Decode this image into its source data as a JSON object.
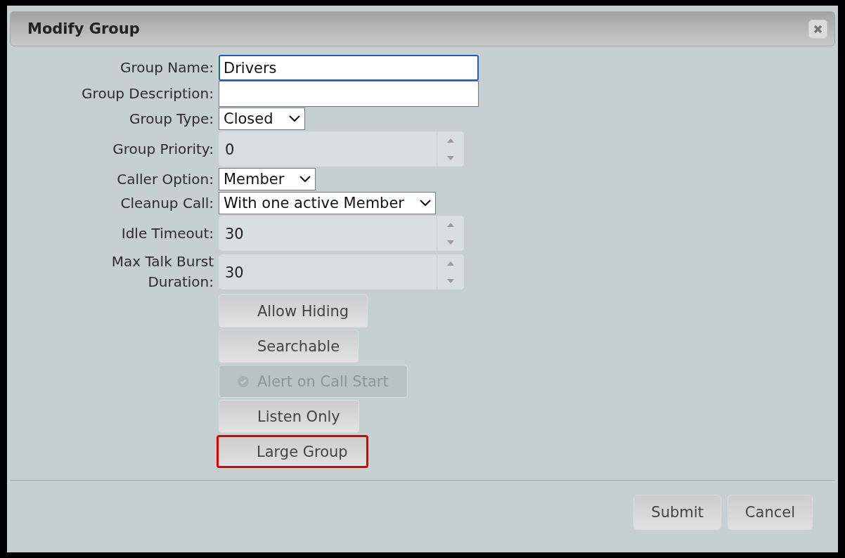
{
  "dialog": {
    "title": "Modify Group"
  },
  "fields": [
    {
      "kind": "text",
      "label": "Group Name:",
      "value": "Drivers",
      "focused": true
    },
    {
      "kind": "text",
      "label": "Group Description:",
      "focused": false
    },
    {
      "kind": "select",
      "label": "Group Type:",
      "value": "Closed"
    },
    {
      "kind": "spinner",
      "label": "Group Priority:",
      "value": "0"
    },
    {
      "kind": "select",
      "label": "Caller Option:",
      "value": "Member"
    },
    {
      "kind": "select",
      "label": "Cleanup Call:",
      "value": "With one active Member"
    },
    {
      "kind": "spinner",
      "label": "Idle Timeout:",
      "value": "30"
    },
    {
      "kind": "spinner",
      "label": "Max Talk Burst\nDuration:",
      "value": "30"
    }
  ],
  "toggles": [
    {
      "label": "Allow Hiding",
      "checked": false,
      "disabled": false,
      "highlighted": false
    },
    {
      "label": "Searchable",
      "checked": false,
      "disabled": false,
      "highlighted": false
    },
    {
      "label": "Alert on Call Start",
      "checked": true,
      "disabled": true,
      "highlighted": false
    },
    {
      "label": "Listen Only",
      "checked": false,
      "disabled": false,
      "highlighted": false
    },
    {
      "label": "Large Group",
      "checked": false,
      "disabled": false,
      "highlighted": true
    }
  ],
  "buttons": [
    "Submit",
    "Cancel"
  ]
}
